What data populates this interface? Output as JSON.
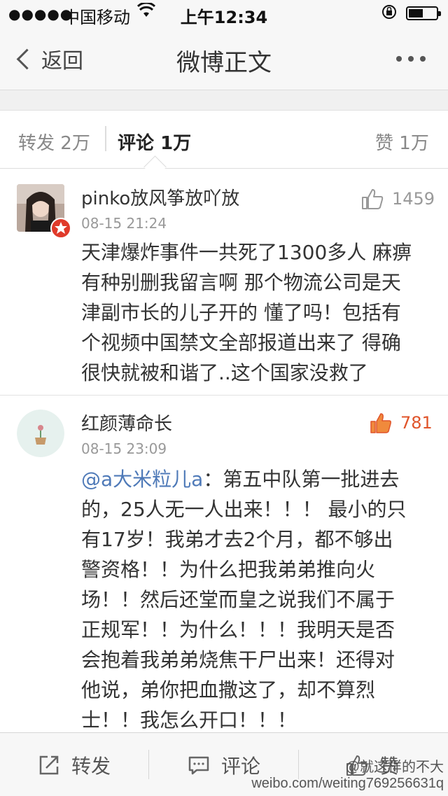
{
  "status_bar": {
    "signal": "●●●●●",
    "carrier": "中国移动",
    "time": "上午12:34"
  },
  "nav": {
    "back_label": "返回",
    "title": "微博正文"
  },
  "tabs": [
    {
      "label": "转发",
      "count": "2万"
    },
    {
      "label": "评论",
      "count": "1万"
    },
    {
      "label": "赞",
      "count": "1万"
    }
  ],
  "comments": [
    {
      "name": "pinko放风筝放吖放",
      "time": "08-15 21:24",
      "likes": "1459",
      "liked": false,
      "lines": [
        "天津爆炸事件一共死了1300多人 麻痹",
        "有种别删我留言啊 那个物流公司是天",
        "津副市长的儿子开的 懂了吗！包括有",
        "个视频中国禁文全部报道出来了 得确",
        "很快就被和谐了..这个国家没救了"
      ]
    },
    {
      "name": "红颜薄命长",
      "time": "08-15 23:09",
      "likes": "781",
      "liked": true,
      "mention": "@a大米粒儿a",
      "first_line_rest": "：第五中队第一批进去",
      "lines": [
        "的，25人无一人出来！！！ 最小的只",
        "有17岁！我弟才去2个月，都不够出",
        "警资格！！为什么把我弟弟推向火",
        "场！！然后还堂而皇之说我们不属于",
        "正规军！！为什么！！！我明天是否",
        "会抱着我弟弟烧焦干尸出来！还得对",
        "他说，弟你把血撒这了，却不算烈",
        "士！！我怎么开口！！！"
      ]
    }
  ],
  "toolbar": {
    "repost_label": "转发",
    "comment_label": "评论",
    "like_label": "赞"
  },
  "watermark": "weibo.com/weiting769256631q",
  "watermark_handle": "@就这样的不大",
  "colors": {
    "liked_accent": "#e0542a",
    "mention": "#4f7ab8"
  },
  "icons": [
    "wifi-icon",
    "lock-rotation-icon",
    "battery-icon",
    "back-chevron-icon",
    "more-icon",
    "thumb-up-icon",
    "repost-icon",
    "comment-icon"
  ]
}
